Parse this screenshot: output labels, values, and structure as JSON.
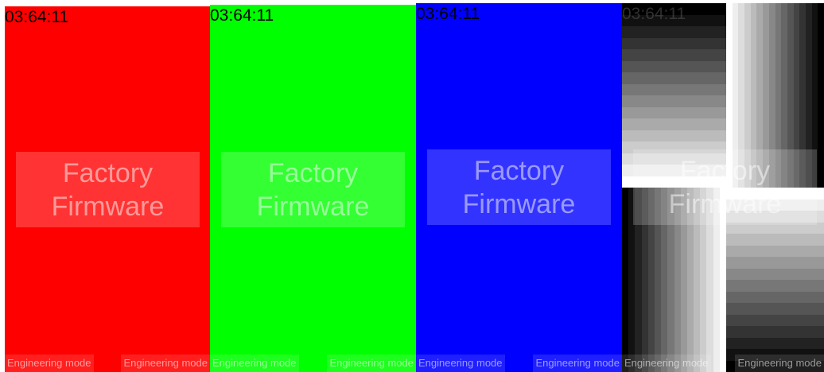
{
  "panels": [
    {
      "id": "panel-red",
      "color": "#ff0000",
      "clock": "03:64:11",
      "watermark": [
        "Factory",
        "Firmware"
      ],
      "engineering_left": "Engineering mode",
      "engineering_right": "Engineering mode"
    },
    {
      "id": "panel-green",
      "color": "#00ff00",
      "clock": "03:64:11",
      "watermark": [
        "Factory",
        "Firmware"
      ],
      "engineering_left": "Engineering mode",
      "engineering_right": "Engineering mode"
    },
    {
      "id": "panel-blue",
      "color": "#0000ff",
      "clock": "03:64:11",
      "watermark": [
        "Factory",
        "Firmware"
      ],
      "engineering_left": "Engineering mode",
      "engineering_right": "Engineering mode"
    },
    {
      "id": "panel-gray",
      "color": "grayscale-ramp",
      "clock": "03:64:11",
      "watermark": [
        "Factory",
        "Firmware"
      ],
      "engineering_left": "Engineering mode",
      "engineering_right": "Engineering mode"
    }
  ]
}
